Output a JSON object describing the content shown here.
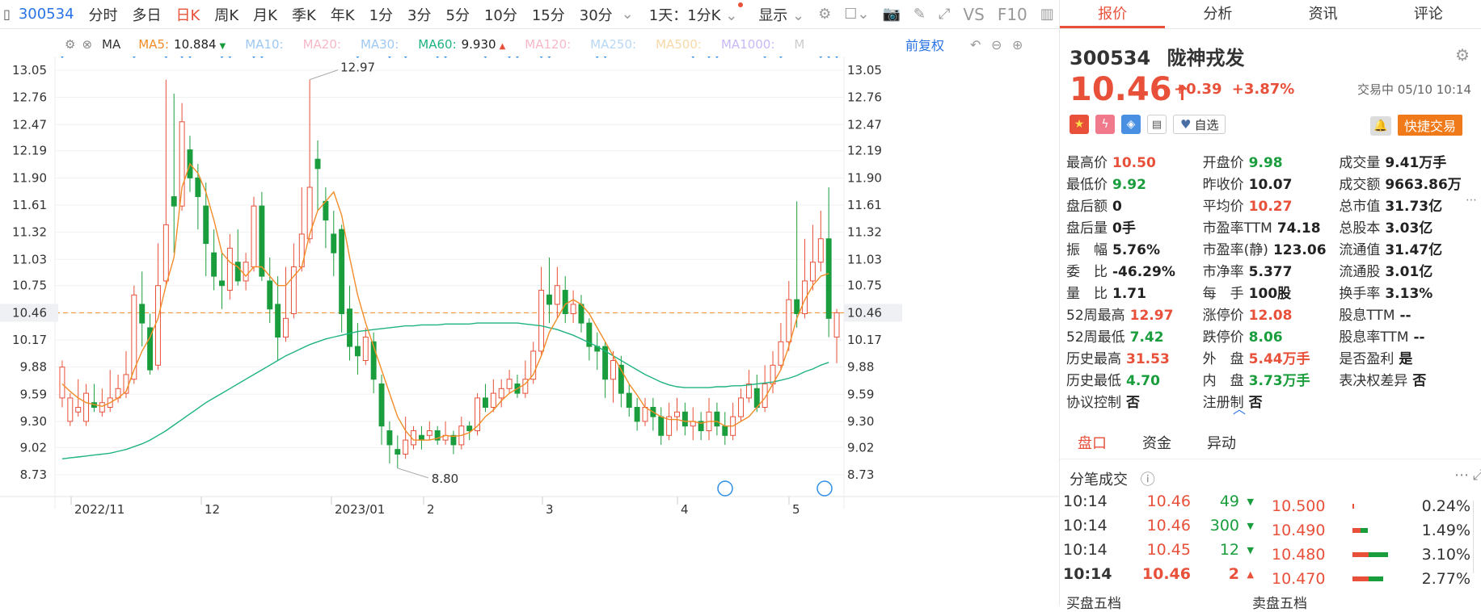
{
  "toolbar": {
    "code": "300534",
    "items": [
      "分时",
      "多日",
      "日K",
      "周K",
      "月K",
      "季K",
      "年K",
      "1分",
      "3分",
      "5分",
      "10分",
      "15分",
      "30分"
    ],
    "active": "日K",
    "dropdown1": "1天：1分K",
    "dropdown2": "显示",
    "vs": "VS",
    "f10": "F10"
  },
  "ma_bar": {
    "ma_label": "MA",
    "items": [
      {
        "label": "MA5:",
        "value": "10.884",
        "color": "#f28c28",
        "arrow": "▼",
        "arrowColor": "#1a9d3d"
      },
      {
        "label": "MA10:",
        "value": "",
        "color": "#9ec9f2"
      },
      {
        "label": "MA20:",
        "value": "",
        "color": "#f7b8c8"
      },
      {
        "label": "MA30:",
        "value": "",
        "color": "#9ec9f2"
      },
      {
        "label": "MA60:",
        "value": "9.930",
        "color": "#1eb37f",
        "arrow": "▲",
        "arrowColor": "#e8503a"
      },
      {
        "label": "MA120:",
        "value": "",
        "color": "#f7b8c8"
      },
      {
        "label": "MA250:",
        "value": "",
        "color": "#b8d8f7"
      },
      {
        "label": "MA500:",
        "value": "",
        "color": "#f7d8a8"
      },
      {
        "label": "MA1000:",
        "value": "",
        "color": "#c8b8f7"
      },
      {
        "label": "M",
        "value": "",
        "color": "#ccc"
      }
    ],
    "adjust": "前复权"
  },
  "chart_data": {
    "type": "candlestick",
    "y_ticks": [
      "13.05",
      "12.76",
      "12.47",
      "12.19",
      "11.90",
      "11.61",
      "11.32",
      "11.03",
      "10.75",
      "10.46",
      "10.17",
      "9.88",
      "9.59",
      "9.30",
      "9.02",
      "8.73"
    ],
    "x_labels": [
      "2022/11",
      "12",
      "2023/01",
      "2",
      "3",
      "4",
      "5"
    ],
    "current_price": "10.46",
    "annotations": {
      "high": "12.97",
      "low": "8.80"
    },
    "colors": {
      "up": "#e8503a",
      "down": "#1a9d3d",
      "ma5": "#f28c28",
      "ma60": "#1eb37f",
      "marker": "#2f8fe6"
    },
    "candles": [
      [
        9.55,
        9.88,
        9.95,
        9.45
      ],
      [
        9.3,
        9.55,
        9.6,
        9.25
      ],
      [
        9.4,
        9.45,
        9.75,
        9.35
      ],
      [
        9.3,
        9.6,
        9.7,
        9.25
      ],
      [
        9.5,
        9.45,
        9.7,
        9.4
      ],
      [
        9.4,
        9.5,
        9.65,
        9.35
      ],
      [
        9.45,
        9.55,
        9.85,
        9.4
      ],
      [
        9.55,
        9.65,
        9.8,
        9.5
      ],
      [
        9.6,
        9.8,
        10.05,
        9.55
      ],
      [
        9.75,
        10.65,
        10.75,
        9.7
      ],
      [
        10.55,
        10.35,
        10.9,
        10.1
      ],
      [
        10.3,
        9.85,
        10.45,
        9.8
      ],
      [
        9.9,
        10.75,
        11.2,
        9.85
      ],
      [
        10.8,
        11.4,
        12.95,
        10.75
      ],
      [
        11.7,
        11.6,
        12.8,
        11.1
      ],
      [
        11.6,
        12.5,
        12.7,
        11.55
      ],
      [
        12.2,
        11.9,
        12.35,
        11.75
      ],
      [
        11.9,
        11.7,
        12.05,
        11.35
      ],
      [
        11.6,
        11.2,
        11.85,
        10.85
      ],
      [
        11.1,
        10.85,
        11.35,
        10.7
      ],
      [
        10.8,
        10.75,
        11.1,
        10.5
      ],
      [
        10.7,
        11.15,
        11.3,
        10.6
      ],
      [
        11.0,
        10.8,
        11.35,
        10.75
      ],
      [
        10.8,
        11.0,
        11.1,
        10.7
      ],
      [
        10.95,
        11.6,
        11.7,
        10.9
      ],
      [
        11.6,
        10.85,
        11.75,
        10.8
      ],
      [
        10.8,
        10.5,
        11.05,
        10.35
      ],
      [
        10.55,
        10.2,
        10.85,
        9.95
      ],
      [
        10.2,
        10.4,
        10.95,
        10.15
      ],
      [
        10.45,
        10.95,
        11.2,
        10.4
      ],
      [
        10.95,
        11.3,
        11.8,
        10.9
      ],
      [
        11.25,
        11.8,
        12.95,
        11.2
      ],
      [
        12.1,
        12.0,
        12.3,
        11.55
      ],
      [
        11.65,
        11.45,
        11.8,
        11.15
      ],
      [
        11.3,
        11.1,
        11.55,
        10.85
      ],
      [
        11.35,
        10.45,
        11.4,
        10.25
      ],
      [
        10.5,
        10.1,
        10.75,
        9.95
      ],
      [
        10.1,
        10.0,
        10.35,
        9.8
      ],
      [
        9.95,
        10.2,
        10.3,
        9.9
      ],
      [
        10.15,
        9.75,
        10.25,
        9.6
      ],
      [
        9.7,
        9.25,
        9.8,
        9.05
      ],
      [
        9.2,
        9.05,
        9.3,
        8.85
      ],
      [
        9.0,
        8.95,
        9.15,
        8.8
      ],
      [
        8.95,
        9.1,
        9.35,
        8.9
      ],
      [
        9.05,
        9.2,
        9.25,
        9.0
      ],
      [
        9.15,
        9.1,
        9.25,
        9.0
      ],
      [
        9.15,
        9.2,
        9.3,
        9.1
      ],
      [
        9.2,
        9.1,
        9.25,
        9.05
      ],
      [
        9.1,
        9.15,
        9.3,
        9.05
      ],
      [
        9.15,
        9.05,
        9.2,
        8.95
      ],
      [
        9.05,
        9.25,
        9.35,
        9.0
      ],
      [
        9.25,
        9.2,
        9.3,
        9.1
      ],
      [
        9.2,
        9.55,
        9.6,
        9.15
      ],
      [
        9.55,
        9.45,
        9.7,
        9.4
      ],
      [
        9.45,
        9.6,
        9.75,
        9.4
      ],
      [
        9.55,
        9.65,
        9.75,
        9.45
      ],
      [
        9.65,
        9.75,
        9.85,
        9.6
      ],
      [
        9.7,
        9.6,
        9.8,
        9.55
      ],
      [
        9.6,
        9.75,
        9.95,
        9.55
      ],
      [
        9.75,
        10.05,
        10.15,
        9.7
      ],
      [
        10.05,
        10.7,
        10.95,
        10.0
      ],
      [
        10.65,
        10.55,
        11.05,
        10.35
      ],
      [
        10.55,
        10.75,
        10.95,
        10.4
      ],
      [
        10.7,
        10.45,
        10.85,
        10.35
      ],
      [
        10.45,
        10.55,
        10.7,
        10.35
      ],
      [
        10.55,
        10.35,
        10.65,
        10.25
      ],
      [
        10.35,
        10.1,
        10.4,
        9.95
      ],
      [
        10.1,
        10.05,
        10.25,
        9.85
      ],
      [
        10.1,
        9.75,
        10.15,
        9.55
      ],
      [
        9.75,
        9.95,
        10.05,
        9.5
      ],
      [
        9.9,
        9.6,
        10.0,
        9.45
      ],
      [
        9.6,
        9.45,
        9.7,
        9.35
      ],
      [
        9.45,
        9.3,
        9.55,
        9.2
      ],
      [
        9.3,
        9.45,
        9.55,
        9.25
      ],
      [
        9.45,
        9.35,
        9.55,
        9.2
      ],
      [
        9.35,
        9.15,
        9.45,
        9.05
      ],
      [
        9.15,
        9.35,
        9.5,
        9.1
      ],
      [
        9.35,
        9.4,
        9.55,
        9.2
      ],
      [
        9.4,
        9.25,
        9.5,
        9.15
      ],
      [
        9.25,
        9.3,
        9.45,
        9.1
      ],
      [
        9.3,
        9.2,
        9.4,
        9.1
      ],
      [
        9.2,
        9.4,
        9.55,
        9.1
      ],
      [
        9.4,
        9.25,
        9.5,
        9.15
      ],
      [
        9.25,
        9.15,
        9.4,
        9.05
      ],
      [
        9.15,
        9.35,
        9.5,
        9.1
      ],
      [
        9.35,
        9.55,
        9.65,
        9.3
      ],
      [
        9.55,
        9.7,
        9.85,
        9.5
      ],
      [
        9.65,
        9.45,
        9.8,
        9.4
      ],
      [
        9.45,
        9.7,
        9.9,
        9.4
      ],
      [
        9.7,
        9.9,
        10.05,
        9.6
      ],
      [
        9.9,
        10.15,
        10.35,
        9.85
      ],
      [
        10.15,
        10.6,
        10.8,
        10.05
      ],
      [
        10.6,
        10.45,
        11.65,
        10.3
      ],
      [
        10.45,
        10.8,
        11.25,
        10.4
      ],
      [
        10.8,
        11.0,
        11.4,
        10.7
      ],
      [
        11.0,
        11.25,
        11.55,
        10.9
      ],
      [
        11.25,
        10.4,
        11.8,
        10.2
      ],
      [
        10.2,
        10.46,
        10.5,
        9.92
      ]
    ],
    "ma5": [
      9.7,
      9.62,
      9.55,
      9.5,
      9.48,
      9.46,
      9.5,
      9.55,
      9.62,
      9.85,
      10.05,
      10.2,
      10.4,
      10.75,
      11.05,
      11.8,
      12.05,
      11.95,
      11.75,
      11.45,
      11.1,
      11.0,
      10.95,
      10.85,
      10.95,
      10.95,
      10.85,
      10.75,
      10.75,
      10.85,
      10.95,
      11.3,
      11.55,
      11.65,
      11.75,
      11.5,
      11.05,
      10.65,
      10.35,
      10.1,
      9.85,
      9.6,
      9.35,
      9.2,
      9.1,
      9.1,
      9.1,
      9.12,
      9.15,
      9.14,
      9.15,
      9.18,
      9.25,
      9.35,
      9.42,
      9.52,
      9.6,
      9.65,
      9.7,
      9.8,
      10.0,
      10.25,
      10.4,
      10.55,
      10.6,
      10.55,
      10.45,
      10.3,
      10.15,
      10.0,
      9.85,
      9.7,
      9.58,
      9.45,
      9.4,
      9.35,
      9.32,
      9.32,
      9.3,
      9.3,
      9.28,
      9.3,
      9.3,
      9.25,
      9.25,
      9.3,
      9.35,
      9.45,
      9.55,
      9.7,
      9.85,
      10.1,
      10.4,
      10.6,
      10.75,
      10.85,
      10.88
    ],
    "ma60": [
      8.9,
      8.91,
      8.92,
      8.93,
      8.94,
      8.95,
      8.96,
      8.98,
      9.0,
      9.03,
      9.06,
      9.1,
      9.15,
      9.2,
      9.26,
      9.32,
      9.38,
      9.44,
      9.5,
      9.55,
      9.6,
      9.65,
      9.7,
      9.75,
      9.8,
      9.85,
      9.9,
      9.95,
      10.0,
      10.04,
      10.08,
      10.12,
      10.15,
      10.18,
      10.2,
      10.22,
      10.24,
      10.26,
      10.27,
      10.28,
      10.29,
      10.3,
      10.31,
      10.32,
      10.32,
      10.33,
      10.33,
      10.33,
      10.34,
      10.34,
      10.34,
      10.34,
      10.35,
      10.35,
      10.35,
      10.35,
      10.35,
      10.35,
      10.34,
      10.33,
      10.32,
      10.3,
      10.28,
      10.25,
      10.22,
      10.18,
      10.14,
      10.1,
      10.05,
      10.0,
      9.95,
      9.9,
      9.85,
      9.8,
      9.76,
      9.72,
      9.69,
      9.67,
      9.66,
      9.66,
      9.66,
      9.66,
      9.67,
      9.67,
      9.68,
      9.68,
      9.69,
      9.7,
      9.71,
      9.72,
      9.74,
      9.76,
      9.79,
      9.83,
      9.86,
      9.9,
      9.93
    ]
  },
  "panel": {
    "tabs": [
      "报价",
      "分析",
      "资讯",
      "评论"
    ],
    "active_tab": "报价",
    "code": "300534",
    "name": "陇神戎发",
    "price": "10.46",
    "change": "+0.39",
    "change_pct": "+3.87%",
    "status_time": "交易中 05/10 10:14",
    "watch_label": "自选",
    "quick_trade": "快捷交易",
    "facts": [
      [
        {
          "k": "最高价",
          "v": "10.50",
          "c": "red"
        },
        {
          "k": "开盘价",
          "v": "9.98",
          "c": "green"
        },
        {
          "k": "成交量",
          "v": "9.41万手",
          "c": "blk"
        }
      ],
      [
        {
          "k": "最低价",
          "v": "9.92",
          "c": "green"
        },
        {
          "k": "昨收价",
          "v": "10.07",
          "c": "blk"
        },
        {
          "k": "成交额",
          "v": "9663.86万",
          "c": "blk"
        }
      ],
      [
        {
          "k": "盘后额",
          "v": "0",
          "c": "blk"
        },
        {
          "k": "平均价",
          "v": "10.27",
          "c": "red"
        },
        {
          "k": "总市值",
          "v": "31.73亿",
          "c": "blk"
        }
      ],
      [
        {
          "k": "盘后量",
          "v": "0手",
          "c": "blk"
        },
        {
          "k": "市盈率TTM",
          "v": "74.18",
          "c": "blk"
        },
        {
          "k": "总股本",
          "v": "3.03亿",
          "c": "blk"
        }
      ],
      [
        {
          "k": "振　幅",
          "v": "5.76%",
          "c": "blk"
        },
        {
          "k": "市盈率(静)",
          "v": "123.06",
          "c": "blk"
        },
        {
          "k": "流通值",
          "v": "31.47亿",
          "c": "blk"
        }
      ],
      [
        {
          "k": "委　比",
          "v": "-46.29%",
          "c": "blk"
        },
        {
          "k": "市净率",
          "v": "5.377",
          "c": "blk"
        },
        {
          "k": "流通股",
          "v": "3.01亿",
          "c": "blk"
        }
      ],
      [
        {
          "k": "量　比",
          "v": "1.71",
          "c": "blk"
        },
        {
          "k": "每　手",
          "v": "100股",
          "c": "blk"
        },
        {
          "k": "换手率",
          "v": "3.13%",
          "c": "blk"
        }
      ],
      [
        {
          "k": "52周最高",
          "v": "12.97",
          "c": "red"
        },
        {
          "k": "涨停价",
          "v": "12.08",
          "c": "red"
        },
        {
          "k": "股息TTM",
          "v": "--",
          "c": "blk"
        }
      ],
      [
        {
          "k": "52周最低",
          "v": "7.42",
          "c": "green"
        },
        {
          "k": "跌停价",
          "v": "8.06",
          "c": "green"
        },
        {
          "k": "股息率TTM",
          "v": "--",
          "c": "blk"
        }
      ],
      [
        {
          "k": "历史最高",
          "v": "31.53",
          "c": "red"
        },
        {
          "k": "外　盘",
          "v": "5.44万手",
          "c": "red"
        },
        {
          "k": "是否盈利",
          "v": "是",
          "c": "blk"
        }
      ],
      [
        {
          "k": "历史最低",
          "v": "4.70",
          "c": "green"
        },
        {
          "k": "内　盘",
          "v": "3.73万手",
          "c": "green"
        },
        {
          "k": "表决权差异",
          "v": "否",
          "c": "blk"
        }
      ],
      [
        {
          "k": "协议控制",
          "v": "否",
          "c": "blk"
        },
        {
          "k": "注册制",
          "v": "否",
          "c": "blk"
        },
        {
          "k": "",
          "v": "",
          "c": "blk"
        }
      ]
    ],
    "sub_tabs": [
      "盘口",
      "资金",
      "异动"
    ],
    "active_sub": "盘口",
    "ticks_title": "分笔成交",
    "ticks": [
      {
        "time": "10:14",
        "price": "10.46",
        "vol": "49",
        "dir": "down"
      },
      {
        "time": "10:14",
        "price": "10.46",
        "vol": "300",
        "dir": "down"
      },
      {
        "time": "10:14",
        "price": "10.45",
        "vol": "12",
        "dir": "down"
      },
      {
        "time": "10:14",
        "price": "10.46",
        "vol": "2",
        "dir": "up"
      }
    ],
    "levels": [
      {
        "price": "10.500",
        "pct": "0.24%",
        "red": 0.03,
        "green": 0
      },
      {
        "price": "10.490",
        "pct": "1.49%",
        "red": 0.13,
        "green": 0.11
      },
      {
        "price": "10.480",
        "pct": "3.10%",
        "red": 0.25,
        "green": 0.3
      },
      {
        "price": "10.470",
        "pct": "2.77%",
        "red": 0.25,
        "green": 0.22
      }
    ],
    "bottom_left": "买盘五档",
    "bottom_right": "卖盘五档"
  }
}
